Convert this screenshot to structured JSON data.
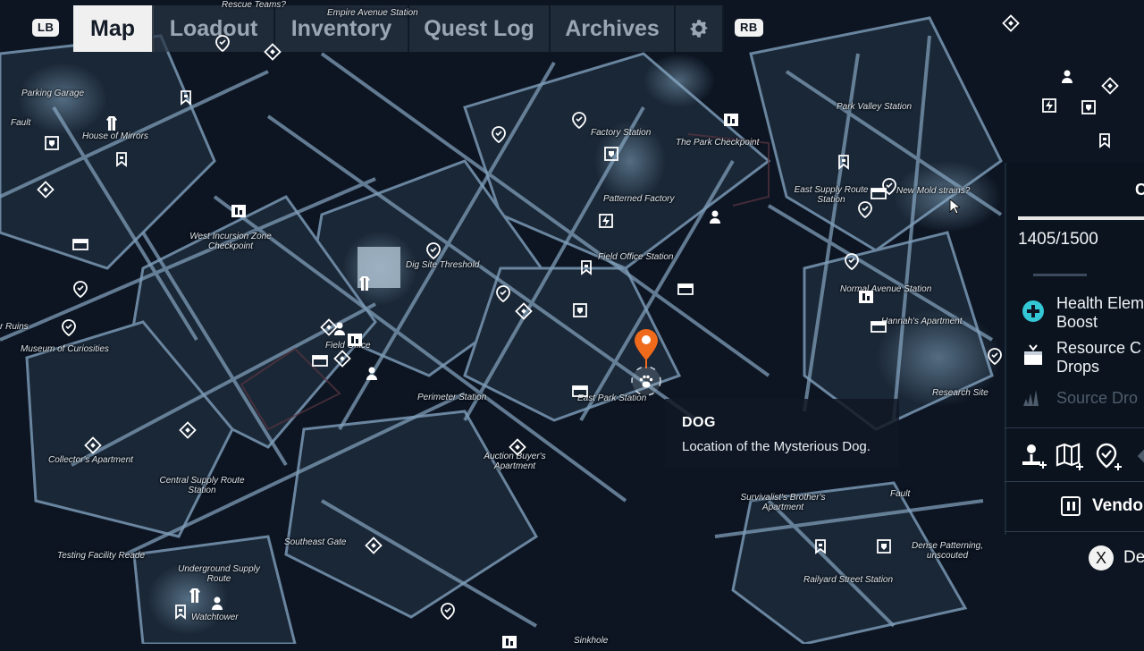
{
  "tabs": {
    "left_bumper": "LB",
    "right_bumper": "RB",
    "items": [
      {
        "label": "Map",
        "active": true
      },
      {
        "label": "Loadout",
        "active": false
      },
      {
        "label": "Inventory",
        "active": false
      },
      {
        "label": "Quest Log",
        "active": false
      },
      {
        "label": "Archives",
        "active": false
      }
    ],
    "settings_icon": "gear-icon"
  },
  "locations": [
    "Rescue Teams?",
    "Empire Avenue Station",
    "Parking Garage",
    "Fault",
    "House of Mirrors",
    "Factory Station",
    "The Park Checkpoint",
    "Park Valley Station",
    "East Supply Route Station",
    "New Mold strains?",
    "Patterned Factory",
    "West Incursion Zone Checkpoint",
    "Dig Site Threshold",
    "Field Office Station",
    "Normal Avenue Station",
    "Hannah's Apartment",
    "Museum of Curiosities",
    "Field Office",
    "Perimeter Station",
    "East Park Station",
    "Research Site",
    "Collector's Apartment",
    "Central Supply Route Station",
    "Auction Buyer's Apartment",
    "Survivalist's Brother's Apartment",
    "Fault",
    "Southeast Gate",
    "Dense Patterning, unscouted",
    "Testing Facility Reade",
    "Underground Supply Route",
    "Railyard Street Station",
    "Watchtower",
    "Sinkhole",
    "r Ruins"
  ],
  "tooltip": {
    "title": "DOG",
    "description": "Location of the Mysterious Dog."
  },
  "selected_marker_icon": "paw-icon",
  "side_panel": {
    "header": "C",
    "score": "1405/1500",
    "progress": 0.937,
    "entries": [
      {
        "icon": "health-cross-icon",
        "label_line1": "Health Elem",
        "label_line2": "Boost",
        "color": "#34c7d6",
        "enabled": true
      },
      {
        "icon": "resource-crate-icon",
        "label_line1": "Resource C",
        "label_line2": "Drops",
        "color": "#ffffff",
        "enabled": true
      },
      {
        "icon": "source-crystal-icon",
        "label_line1": "Source Dro",
        "label_line2": "",
        "color": "#4e5c6c",
        "enabled": false
      }
    ],
    "actions": [
      "add-person-marker-icon",
      "add-map-marker-icon",
      "add-location-marker-icon"
    ],
    "vendor_label": "Vendo",
    "x_button": "X",
    "x_action_label": "De"
  },
  "colors": {
    "background": "#0d1522",
    "marker": "#f06a1c",
    "accent_cyan": "#34c7d6"
  }
}
